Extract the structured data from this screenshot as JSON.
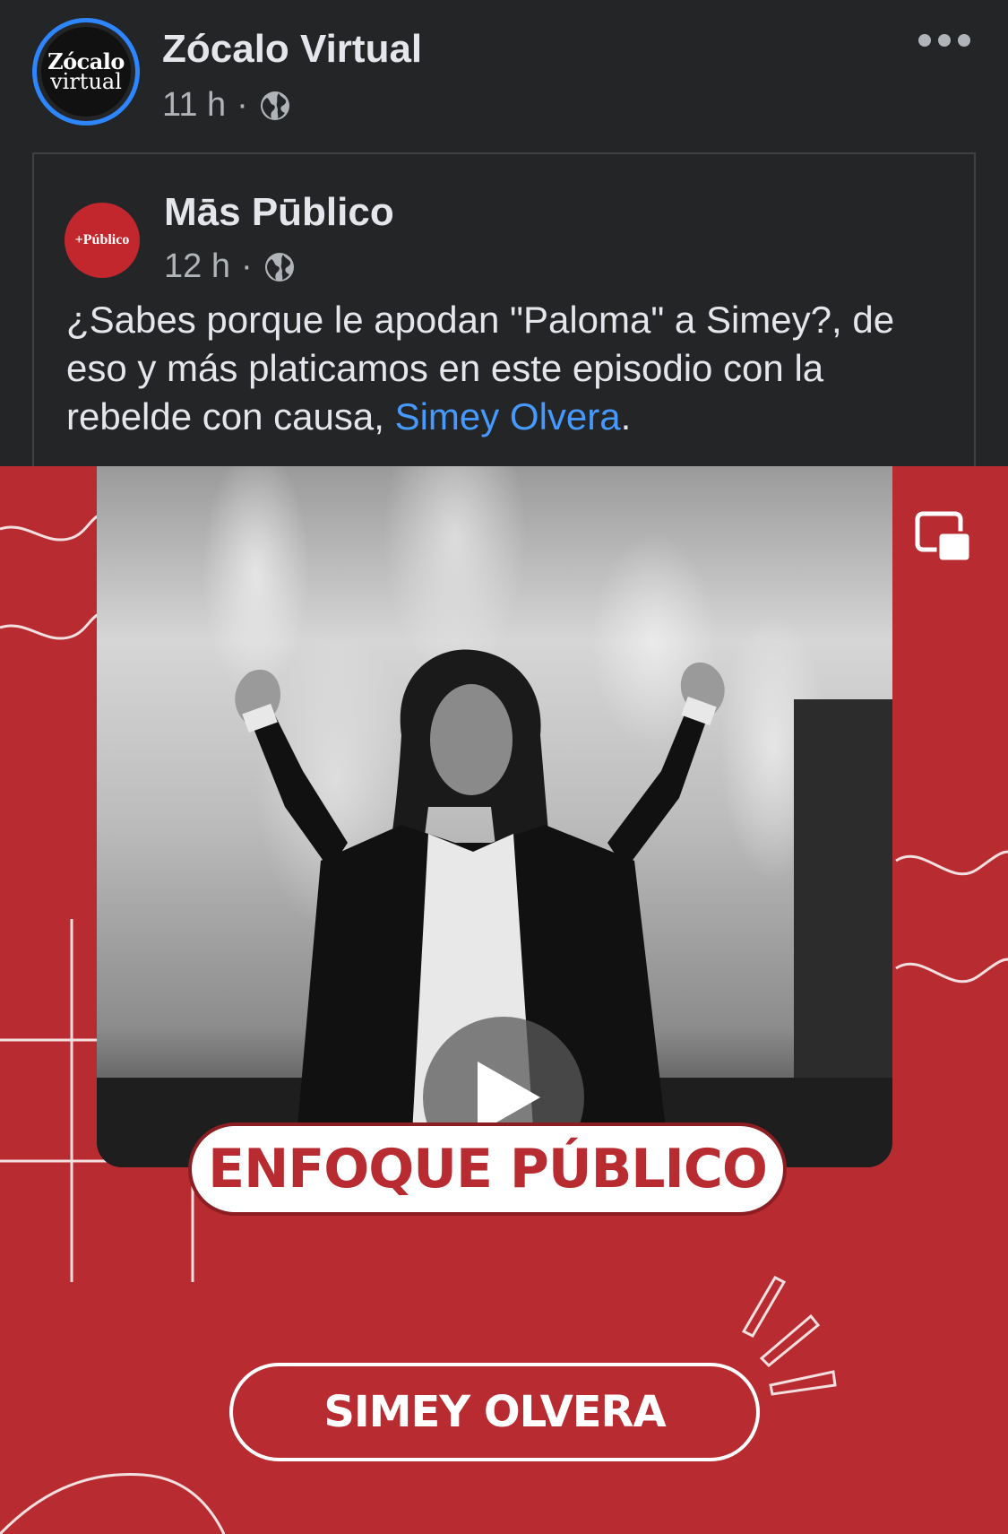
{
  "post": {
    "page_name": "Zócalo Virtual",
    "time": "11 h",
    "separator": "·",
    "avatar_line1": "Zócalo",
    "avatar_line2": "virtual",
    "audience_icon": "globe-icon",
    "more_icon": "more-options-icon"
  },
  "shared_post": {
    "page_name": "Mās Pūblico",
    "avatar_text": "+Público",
    "time": "12 h",
    "separator": "·",
    "text_before_mention": "¿Sabes porque le apodan \"Paloma\" a Simey?, de eso y más platicamos en este episodio con la rebelde con causa, ",
    "mention": "Simey Olvera",
    "text_after_mention": "."
  },
  "media": {
    "type": "video",
    "title_pill": "ENFOQUE PÚBLICO",
    "name_pill": "SIMEY OLVERA",
    "pip_icon": "picture-in-picture-icon",
    "play_icon": "play-icon",
    "colors": {
      "background": "#b72b31",
      "accent": "#ffffff"
    }
  },
  "colors": {
    "page_bg": "#242526",
    "text_primary": "#e4e6eb",
    "text_secondary": "#b0b3b8",
    "link": "#4599ff",
    "avatar_ring": "#2d86ff"
  }
}
